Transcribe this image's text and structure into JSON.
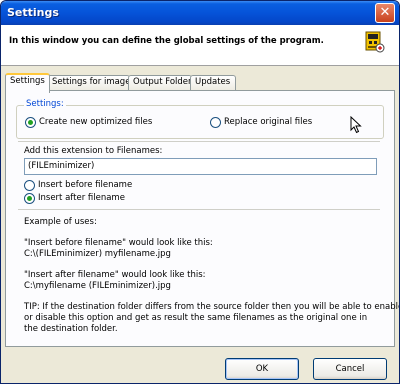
{
  "window": {
    "title": "Settings",
    "close_label": "✕"
  },
  "header": {
    "text": "In this window you can define the global settings of the program.",
    "icon": "program-icon"
  },
  "tabs": [
    {
      "label": "Settings",
      "active": true
    },
    {
      "label": "Settings for images",
      "active": false
    },
    {
      "label": "Output Folder",
      "active": false
    },
    {
      "label": "Updates",
      "active": false
    }
  ],
  "settings": {
    "group_label": "Settings:",
    "option_create": "Create new optimized files",
    "option_replace": "Replace original files",
    "selected_mode": "create",
    "extension_label": "Add this extension to Filenames:",
    "extension_value": "(FILEminimizer)",
    "insert_before": "Insert before filename",
    "insert_after": "Insert after filename",
    "selected_insert": "after"
  },
  "examples": {
    "heading": "Example of uses:",
    "before_line1": "\"Insert before filename\" would look like this:",
    "before_line2": "C:\\(FILEminimizer) myfilename.jpg",
    "after_line1": "\"Insert after filename\" would look like this:",
    "after_line2": "C:\\myfilename (FILEminimizer).jpg",
    "tip_line1": "TIP: If the destination folder differs from the source folder then you will be able to enable",
    "tip_line2": "or disable this option and get as result the same filenames as the original one in",
    "tip_line3": "the destination folder."
  },
  "buttons": {
    "ok": "OK",
    "cancel": "Cancel"
  }
}
